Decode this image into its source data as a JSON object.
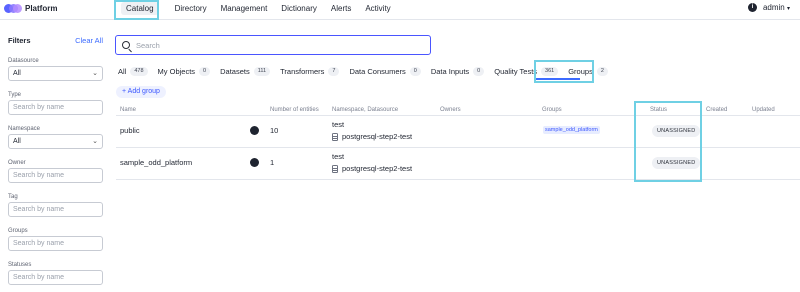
{
  "app": {
    "name": "Platform"
  },
  "nav": [
    "Catalog",
    "Directory",
    "Management",
    "Dictionary",
    "Alerts",
    "Activity"
  ],
  "user": {
    "name": "admin"
  },
  "filters": {
    "title": "Filters",
    "clear_label": "Clear All",
    "datasource": {
      "label": "Datasource",
      "value": "All"
    },
    "type": {
      "label": "Type",
      "placeholder": "Search by name"
    },
    "namespace": {
      "label": "Namespace",
      "value": "All"
    },
    "owner": {
      "label": "Owner",
      "placeholder": "Search by name"
    },
    "tag": {
      "label": "Tag",
      "placeholder": "Search by name"
    },
    "groups": {
      "label": "Groups",
      "placeholder": "Search by name"
    },
    "statuses": {
      "label": "Statuses",
      "placeholder": "Search by name"
    }
  },
  "search": {
    "placeholder": "Search"
  },
  "tabs": [
    {
      "label": "All",
      "count": "478"
    },
    {
      "label": "My Objects",
      "count": "0"
    },
    {
      "label": "Datasets",
      "count": "111"
    },
    {
      "label": "Transformers",
      "count": "7"
    },
    {
      "label": "Data Consumers",
      "count": "0"
    },
    {
      "label": "Data Inputs",
      "count": "0"
    },
    {
      "label": "Quality Tests",
      "count": "361"
    },
    {
      "label": "Groups",
      "count": "2"
    }
  ],
  "add_group_label": "+ Add group",
  "table": {
    "columns": [
      "Name",
      "Number of entities",
      "Namespace, Datasource",
      "Owners",
      "Groups",
      "Status",
      "Created",
      "Updated"
    ],
    "rows": [
      {
        "name": "public",
        "entities": "10",
        "namespace": "test",
        "datasource": "postgresql-step2-test",
        "group": "sample_odd_platform",
        "status": "UNASSIGNED"
      },
      {
        "name": "sample_odd_platform",
        "entities": "1",
        "namespace": "test",
        "datasource": "postgresql-step2-test",
        "group": "",
        "status": "UNASSIGNED"
      }
    ]
  },
  "colors": {
    "accent": "#3c6bff",
    "highlight": "#6fd0e4"
  }
}
